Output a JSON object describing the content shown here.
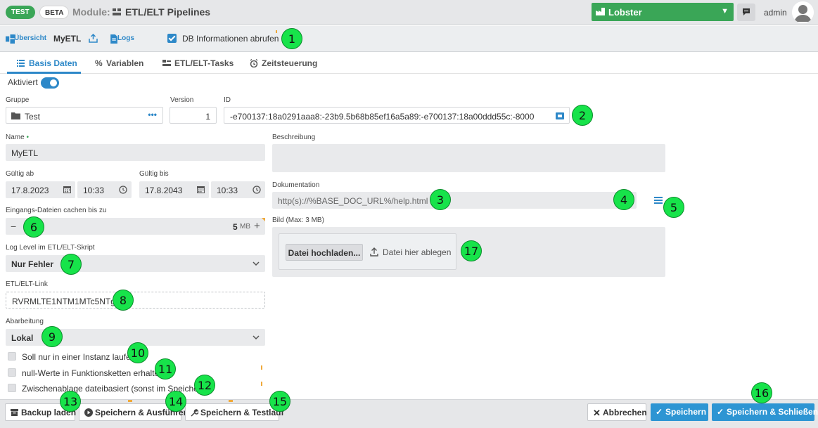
{
  "header": {
    "badge_test": "TEST",
    "badge_beta": "BETA",
    "module_label": "Module:",
    "module_name": "ETL/ELT Pipelines",
    "tenant": "Lobster",
    "user": "admin"
  },
  "toolbar": {
    "overview": "Übersicht",
    "title": "MyETL",
    "logs": "Logs",
    "db_info": "DB Informationen abrufen"
  },
  "tabs": [
    {
      "label": "Basis Daten"
    },
    {
      "label": "Variablen"
    },
    {
      "label": "ETL/ELT-Tasks"
    },
    {
      "label": "Zeitsteuerung"
    }
  ],
  "form": {
    "active_label": "Aktiviert",
    "group_label": "Gruppe",
    "group_value": "Test",
    "version_label": "Version",
    "version_value": "1",
    "id_label": "ID",
    "id_value": "-e700137:18a0291aaa8:-23b9.5b68b85ef16a5a89:-e700137:18a00ddd55c:-8000",
    "name_label": "Name",
    "name_required": "•",
    "name_value": "MyETL",
    "valid_from_label": "Gültig ab",
    "valid_from_date": "17.8.2023",
    "valid_from_time": "10:33",
    "valid_to_label": "Gültig bis",
    "valid_to_date": "17.8.2043",
    "valid_to_time": "10:33",
    "cache_label": "Eingangs-Dateien cachen bis zu",
    "cache_minus": "−",
    "cache_value": "5",
    "cache_unit": "MB",
    "cache_plus": "+",
    "loglevel_label": "Log Level im ETL/ELT-Skript",
    "loglevel_value": "Nur Fehler",
    "link_label": "ETL/ELT-Link",
    "link_value": "RVRMLTE1NTM1MTc5NTg",
    "processing_label": "Abarbeitung",
    "processing_value": "Lokal",
    "check_single_instance": "Soll nur in einer Instanz laufen",
    "check_null_values": "null-Werte in Funktionsketten erhalten",
    "check_clipboard": "Zwischenablage dateibasiert (sonst im Speicher)",
    "description_label": "Beschreibung",
    "documentation_label": "Dokumentation",
    "documentation_value": "http(s)://%BASE_DOC_URL%/help.html",
    "image_label": "Bild (Max: 3 MB)",
    "upload_button": "Datei hochladen...",
    "drop_label": "Datei hier ablegen"
  },
  "footer": {
    "backup": "Backup laden",
    "save_run": "Speichern & Ausführen",
    "save_test": "Speichern & Testlauf",
    "cancel": "Abbrechen",
    "save": "Speichern",
    "save_close": "Speichern & Schließen"
  },
  "markers": [
    "1",
    "2",
    "3",
    "4",
    "5",
    "6",
    "7",
    "8",
    "9",
    "10",
    "11",
    "12",
    "13",
    "14",
    "15",
    "16",
    "17"
  ],
  "colors": {
    "accent": "#2d88c8",
    "brand_green": "#3aa657",
    "marker_green": "#17e34a",
    "warning_orange": "#f0a93a"
  }
}
